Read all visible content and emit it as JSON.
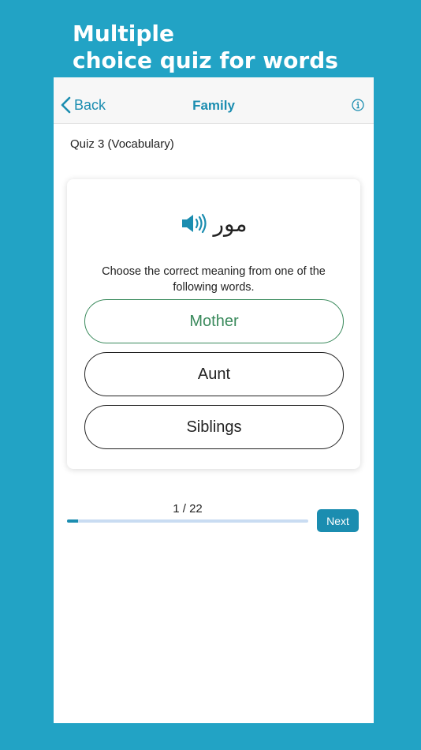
{
  "promo": {
    "line1": "Multiple",
    "line2": "choice quiz for words"
  },
  "nav": {
    "back_label": "Back",
    "title": "Family",
    "info_icon": "info-circle-icon"
  },
  "quiz": {
    "subtitle": "Quiz 3 (Vocabulary)",
    "word": "مور",
    "speaker_icon": "speaker-icon",
    "instruction": "Choose the correct meaning from one of the following words.",
    "options": [
      {
        "label": "Mother",
        "state": "correct"
      },
      {
        "label": "Aunt",
        "state": "default"
      },
      {
        "label": "Siblings",
        "state": "default"
      }
    ]
  },
  "progress": {
    "label": "1 / 22",
    "current": 1,
    "total": 22,
    "next_label": "Next"
  },
  "colors": {
    "background": "#22a3c5",
    "accent": "#1b8db0",
    "correct": "#3a8a5c",
    "track": "#c9dcf2"
  }
}
